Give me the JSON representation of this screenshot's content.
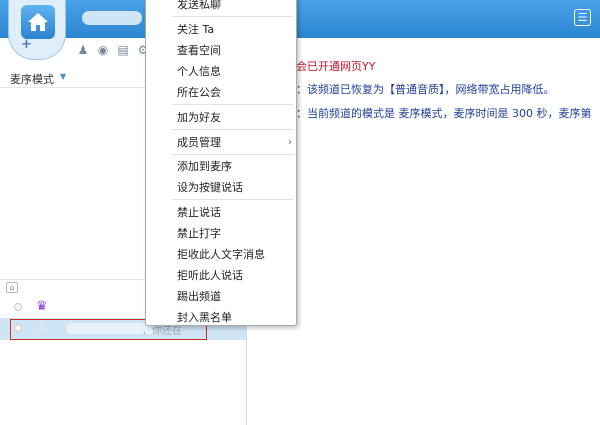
{
  "header": {
    "menu_icon": "list-icon"
  },
  "left_panel": {
    "mode_label": "麦序模式",
    "toolbar_icons": [
      "person-icon",
      "location-icon",
      "notes-icon",
      "settings-icon"
    ],
    "members": [
      {
        "role_icon": "manager-icon",
        "name": "",
        "status": ""
      },
      {
        "role_icon": "member-icon",
        "name": "",
        "status": "，你还在"
      }
    ]
  },
  "chat": {
    "messages": [
      {
        "text": "会已开通网页YY",
        "color": "#c4162a"
      },
      {
        "text": "：该频道已恢复为【普通音质】，网络带宽占用降低。",
        "color": "#1f3f9a"
      },
      {
        "text": "：当前频道的模式是 麦序模式，麦序时间是 300 秒，麦序第",
        "color": "#1f3f9a"
      }
    ]
  },
  "context_menu": {
    "items": [
      {
        "label": "发送私聊"
      },
      {
        "label": "关注 Ta"
      },
      {
        "label": "查看空间"
      },
      {
        "label": "个人信息"
      },
      {
        "label": "所在公会"
      },
      {
        "label": "加为好友"
      },
      {
        "label": "成员管理",
        "submenu": true
      },
      {
        "label": "添加到麦序"
      },
      {
        "label": "设为按键说话"
      },
      {
        "label": "禁止说话"
      },
      {
        "label": "禁止打字"
      },
      {
        "label": "拒收此人文字消息"
      },
      {
        "label": "拒听此人说话"
      },
      {
        "label": "踢出频道"
      },
      {
        "label": "封入黑名单"
      }
    ],
    "submenu_arrow": "›"
  }
}
